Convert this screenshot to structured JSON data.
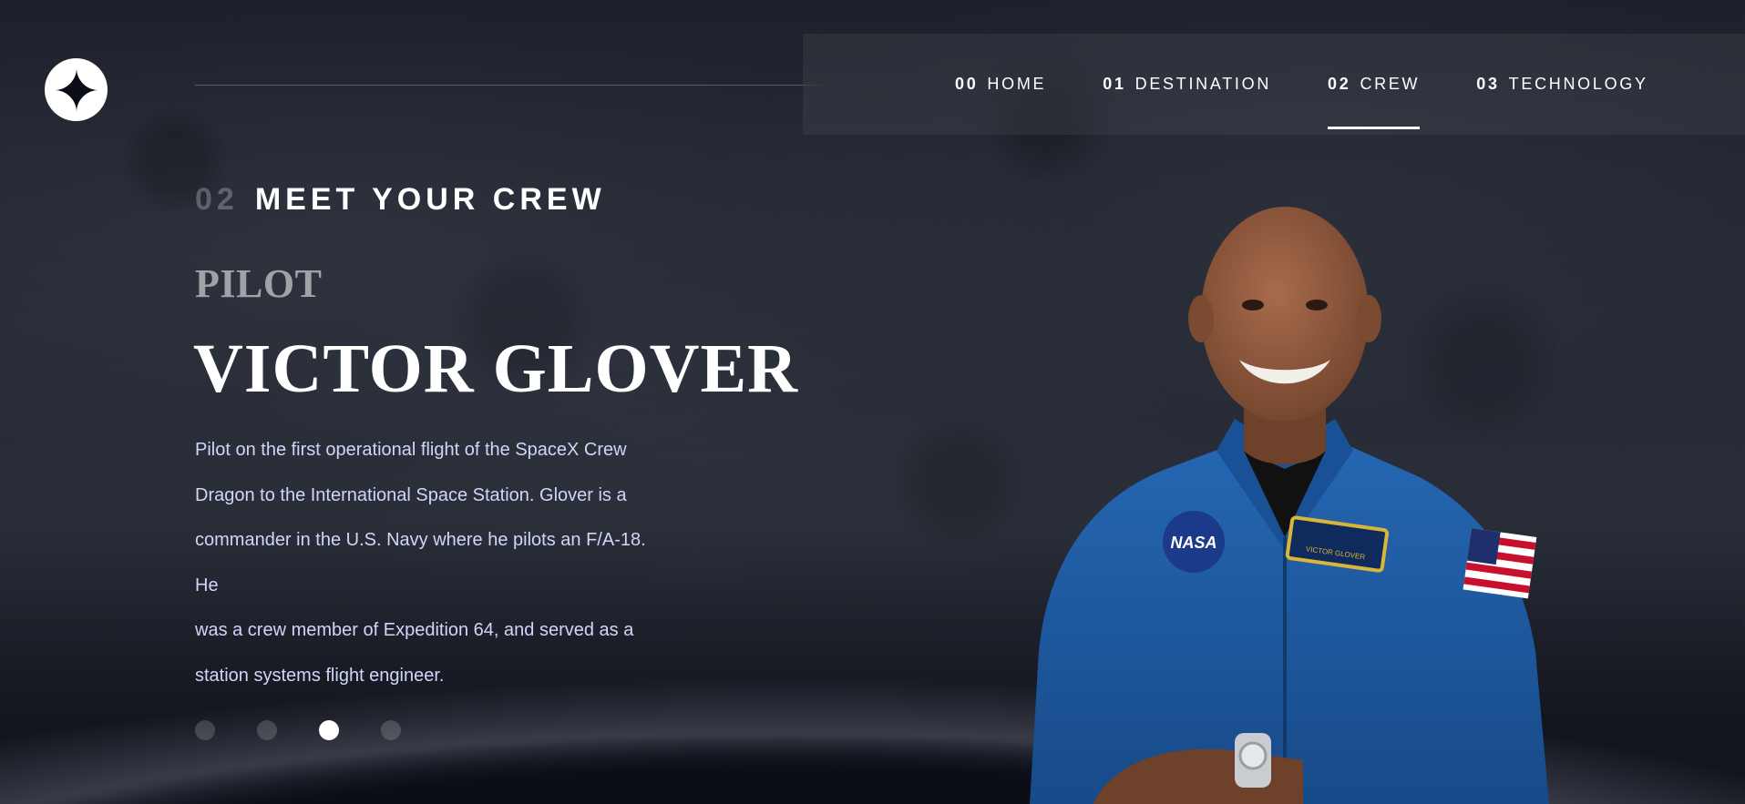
{
  "nav": {
    "items": [
      {
        "num": "00",
        "label": "HOME",
        "active": false
      },
      {
        "num": "01",
        "label": "DESTINATION",
        "active": false
      },
      {
        "num": "02",
        "label": "CREW",
        "active": true
      },
      {
        "num": "03",
        "label": "TECHNOLOGY",
        "active": false
      }
    ]
  },
  "page": {
    "eyebrow_num": "02",
    "eyebrow_text": "MEET YOUR CREW"
  },
  "crew": {
    "role": "PILOT",
    "name": "VICTOR GLOVER",
    "bio": "Pilot on the first operational flight of the SpaceX Crew Dragon to the International Space Station. Glover is a commander in the U.S. Navy where he pilots an F/A-18. He was a crew member of Expedition 64, and served as a station systems flight engineer.",
    "bio_lines": [
      "Pilot on the first operational flight of the SpaceX Crew",
      "Dragon to the International Space Station. Glover is a",
      "commander in the U.S. Navy where he pilots an F/A-18. He",
      "was a crew member of Expedition 64, and served as a",
      "station systems flight engineer."
    ],
    "selected_index": 2,
    "count": 4
  },
  "portrait": {
    "badge_text": "NASA",
    "nametag_text": "VICTOR GLOVER"
  },
  "colors": {
    "background": "#0b0d17",
    "text": "#ffffff",
    "body_text": "#d0d6f9",
    "suit_blue": "#1f5fa8"
  }
}
